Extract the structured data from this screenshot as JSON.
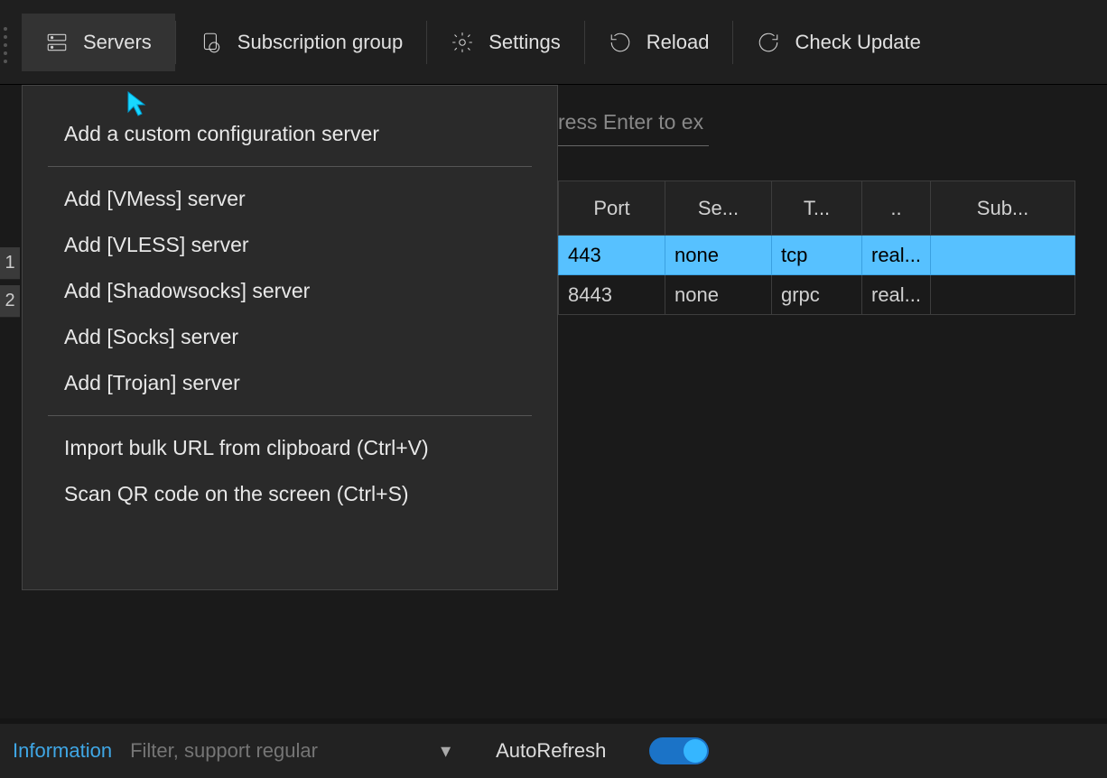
{
  "toolbar": {
    "servers": "Servers",
    "subscription_group": "Subscription group",
    "settings": "Settings",
    "reload": "Reload",
    "check_update": "Check Update"
  },
  "servers_menu": {
    "add_custom": "Add a custom configuration server",
    "add_vmess": "Add [VMess] server",
    "add_vless": "Add [VLESS] server",
    "add_shadowsocks": "Add [Shadowsocks] server",
    "add_socks": "Add [Socks] server",
    "add_trojan": "Add [Trojan] server",
    "import_clipboard": "Import bulk URL from clipboard (Ctrl+V)",
    "scan_qr": "Scan QR code on the screen (Ctrl+S)"
  },
  "search": {
    "placeholder_fragment": "ress Enter to ex"
  },
  "table": {
    "headers": {
      "port": "Port",
      "security": "Se...",
      "transport": "T...",
      "tls": "..",
      "sub": "Sub..."
    },
    "rows": [
      {
        "idx": "1",
        "port": "443",
        "security": "none",
        "transport": "tcp",
        "tls": "real...",
        "sub": "",
        "selected": true
      },
      {
        "idx": "2",
        "port": "8443",
        "security": "none",
        "transport": "grpc",
        "tls": "real...",
        "sub": "",
        "selected": false
      }
    ]
  },
  "bottom": {
    "information": "Information",
    "filter_placeholder": "Filter, support regular",
    "autorefresh": "AutoRefresh"
  }
}
